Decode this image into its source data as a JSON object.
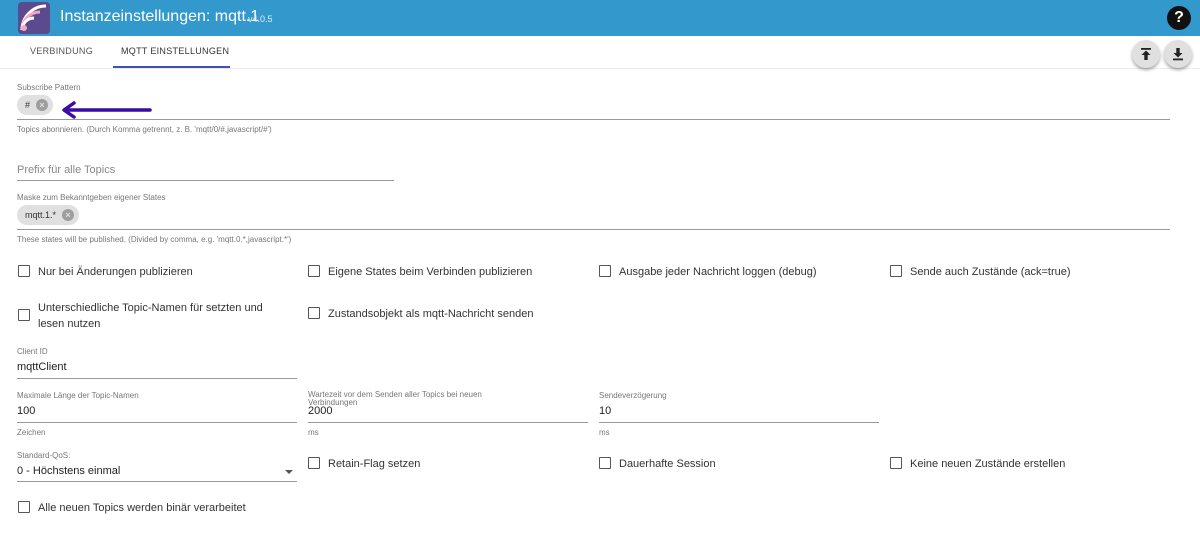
{
  "header": {
    "title": "Instanzeinstellungen: mqtt.1",
    "version": "v4.0.5",
    "help_label": "?"
  },
  "tabs": [
    {
      "label": "VERBINDUNG"
    },
    {
      "label": "MQTT EINSTELLUNGEN"
    }
  ],
  "subscribe": {
    "label": "Subscribe Pattern",
    "chip": "#",
    "helper": "Topics abonnieren. (Durch Komma getrennt, z. B. 'mqtt/0/#,javascript/#')"
  },
  "prefix": {
    "placeholder": "Prefix für alle Topics"
  },
  "mask": {
    "label": "Maske zum Bekanntgeben eigener States",
    "chip": "mqtt.1.*",
    "helper": "These states will be published. (Divided by comma, e.g. 'mqtt.0.*,javascript.*')"
  },
  "checkboxes_row1": [
    {
      "label": "Nur bei Änderungen publizieren"
    },
    {
      "label": "Eigene States beim Verbinden publizieren"
    },
    {
      "label": "Ausgabe jeder Nachricht loggen (debug)"
    },
    {
      "label": "Sende auch Zustände (ack=true)"
    }
  ],
  "checkboxes_row2": [
    {
      "label_line1": "Unterschiedliche Topic-Namen für setzten und",
      "label_line2": "lesen nutzen"
    },
    {
      "label": "Zustandsobjekt als mqtt-Nachricht senden"
    }
  ],
  "client_id": {
    "label": "Client ID",
    "value": "mqttClient"
  },
  "max_topic_length": {
    "label": "Maximale Länge der Topic-Namen",
    "value": "100",
    "helper": "Zeichen"
  },
  "wait_time": {
    "label_line1": "Wartezeit vor dem Senden aller Topics bei neuen",
    "label_line2": "Verbindungen",
    "value": "2000",
    "helper": "ms"
  },
  "send_delay": {
    "label": "Sendeverzögerung",
    "value": "10",
    "helper": "ms"
  },
  "qos": {
    "label": "Standard-QoS:",
    "value": "0 - Höchstens einmal"
  },
  "checkboxes_row3": [
    {
      "label": "Retain-Flag setzen"
    },
    {
      "label": "Dauerhafte Session"
    },
    {
      "label": "Keine neuen Zustände erstellen"
    }
  ],
  "checkbox_binary": {
    "label": "Alle neuen Topics werden binär verarbeitet"
  },
  "colors": {
    "header": "#3399cc",
    "tab_indicator": "#3f51b5",
    "annotation_arrow": "#3a0ca3"
  }
}
